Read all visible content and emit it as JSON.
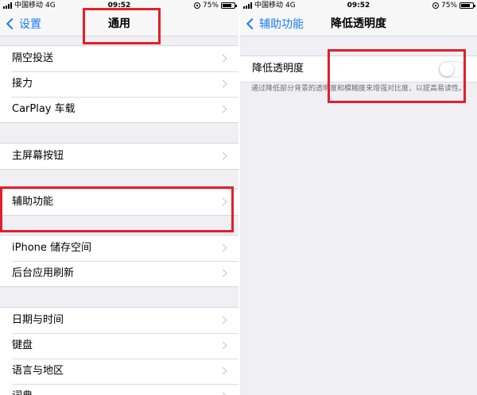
{
  "left": {
    "status_bar": {
      "carrier": "中国移动",
      "network": "4G",
      "time": "09:52",
      "battery": "75%",
      "battery_level": 0.75
    },
    "nav": {
      "back_label": "设置",
      "title": "通用"
    },
    "groups": [
      {
        "items": [
          "隔空投送",
          "接力",
          "CarPlay 车载"
        ]
      },
      {
        "items": [
          "主屏幕按钮"
        ]
      },
      {
        "items": [
          "辅助功能"
        ]
      },
      {
        "items": [
          "iPhone 储存空间",
          "后台应用刷新"
        ]
      },
      {
        "items": [
          "日期与时间",
          "键盘",
          "语言与地区",
          "词典"
        ]
      }
    ]
  },
  "right": {
    "status_bar": {
      "carrier": "中国移动",
      "network": "4G",
      "time": "09:52",
      "battery": "75%",
      "battery_level": 0.75
    },
    "nav": {
      "back_label": "辅助功能",
      "title": "降低透明度"
    },
    "setting": {
      "label": "降低透明度",
      "enabled": false
    },
    "footer": "通过降低部分背景的透明度和模糊度来增强对比度，以提高易读性。"
  },
  "colors": {
    "accent": "#1a7cf8",
    "highlight": "#e21f2b",
    "background": "#efeff4"
  }
}
